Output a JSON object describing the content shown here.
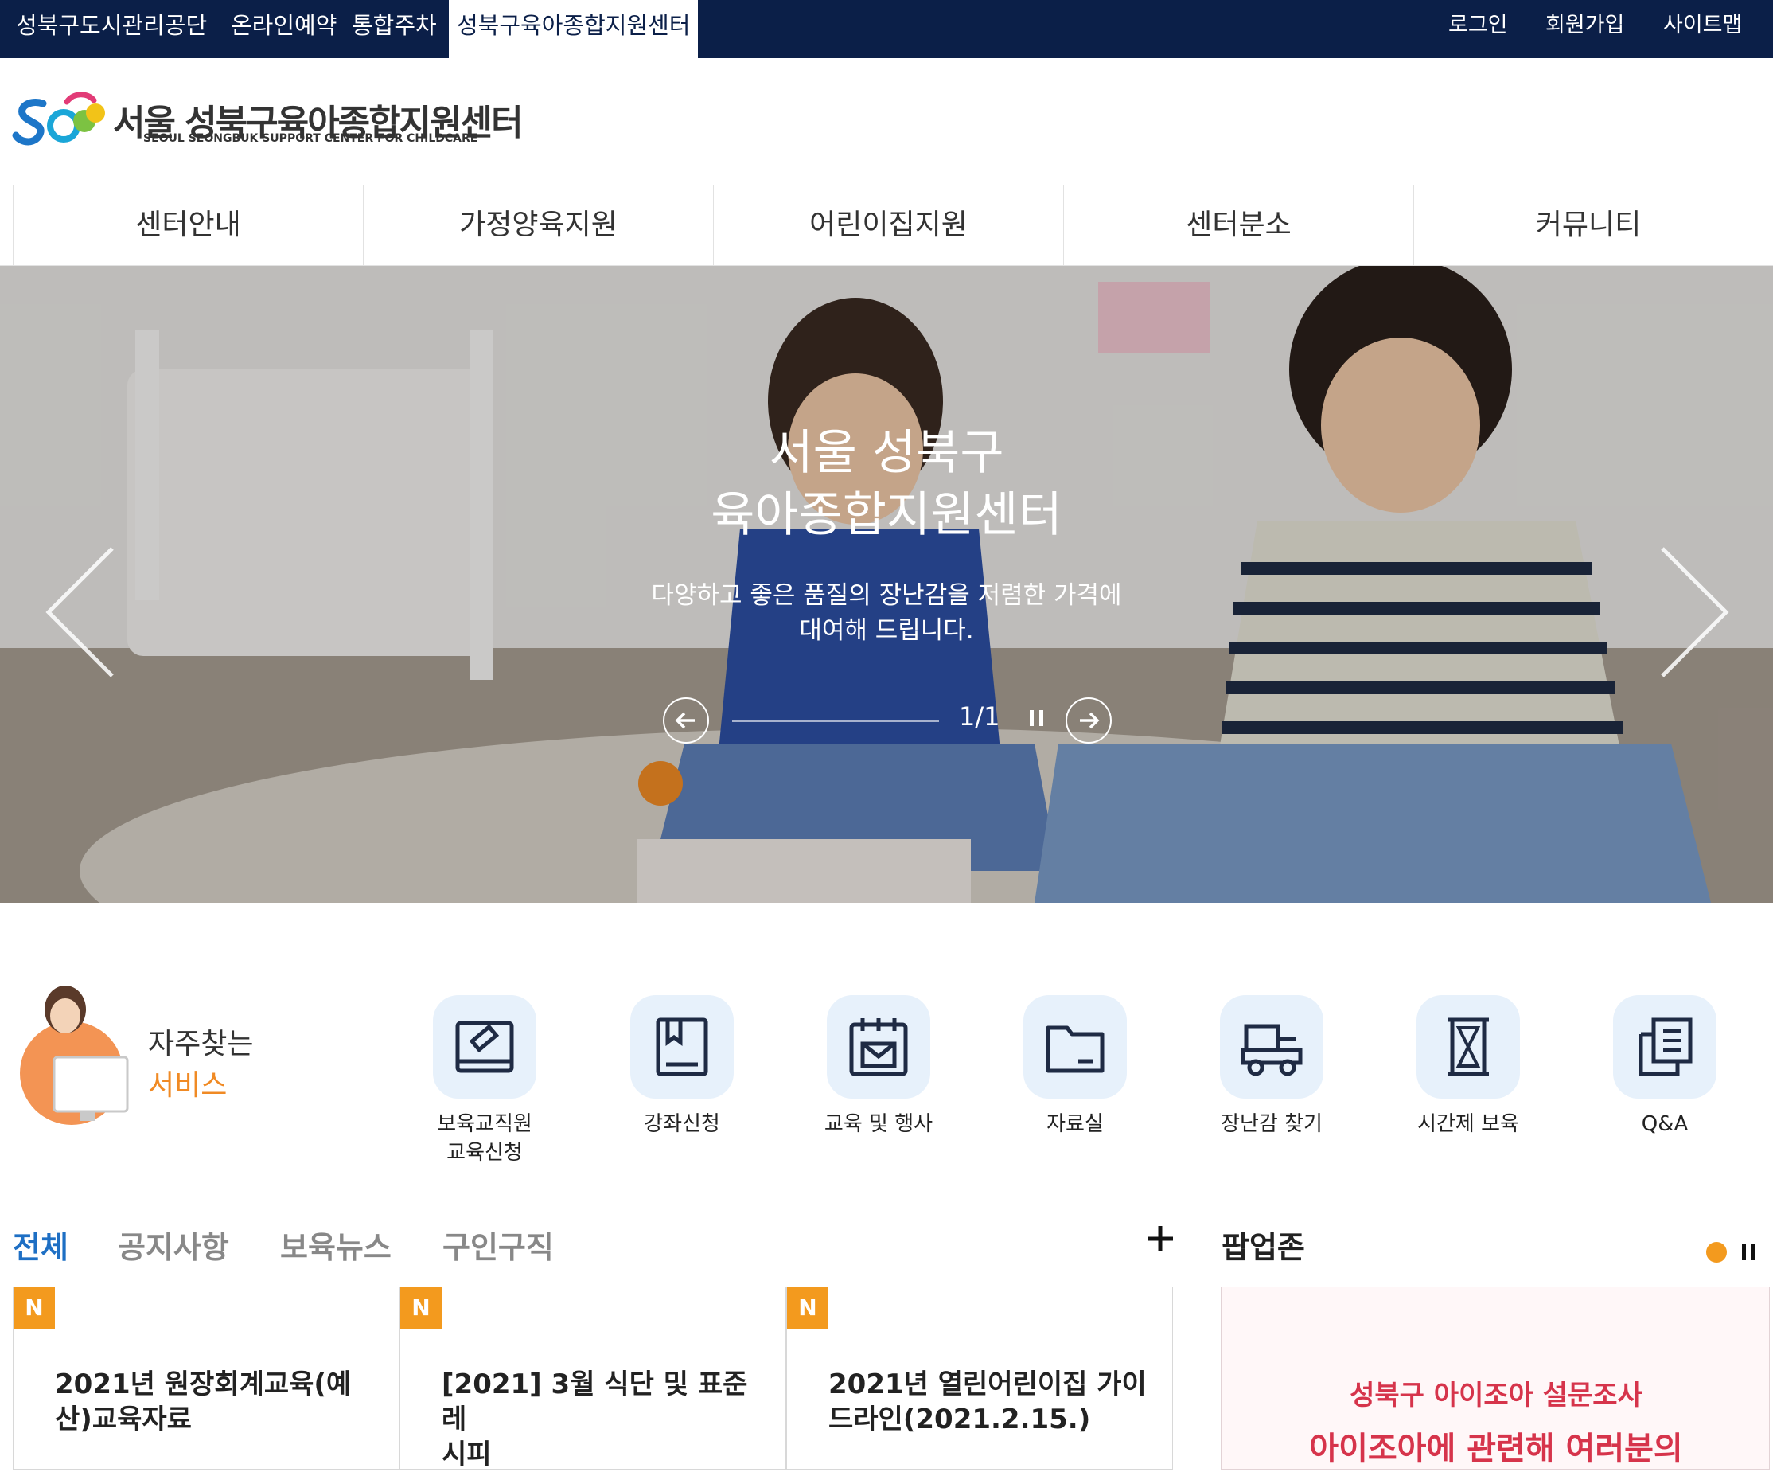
{
  "topbar": {
    "sites": [
      "성북구도시관리공단",
      "온라인예약",
      "통합주차",
      "성북구육아종합지원센터"
    ],
    "utils": [
      "로그인",
      "회원가입",
      "사이트맵"
    ]
  },
  "logo": {
    "name": "서울 성북구육아종합지원센터",
    "en": "SEOUL SEONGBUK SUPPORT CENTER FOR CHILDCARE"
  },
  "nav": [
    "센터안내",
    "가정양육지원",
    "어린이집지원",
    "센터분소",
    "커뮤니티"
  ],
  "hero": {
    "title_line1": "서울 성북구",
    "title_line2": "육아종합지원센터",
    "sub_line1": "다양하고 좋은 품질의 장난감을 저렴한 가격에",
    "sub_line2": "대여해 드립니다.",
    "counter": "1/1"
  },
  "quick": {
    "title1": "자주찾는",
    "title2": "서비스",
    "items": [
      {
        "label1": "보육교직원",
        "label2": "교육신청",
        "icon": "pencil-eraser-icon"
      },
      {
        "label1": "강좌신청",
        "label2": "",
        "icon": "book-bookmark-icon"
      },
      {
        "label1": "교육 및 행사",
        "label2": "",
        "icon": "calendar-mail-icon"
      },
      {
        "label1": "자료실",
        "label2": "",
        "icon": "folder-icon"
      },
      {
        "label1": "장난감 찾기",
        "label2": "",
        "icon": "toy-truck-icon"
      },
      {
        "label1": "시간제 보육",
        "label2": "",
        "icon": "hourglass-icon"
      },
      {
        "label1": "Q&A",
        "label2": "",
        "icon": "document-icon"
      }
    ]
  },
  "board": {
    "tabs": [
      "전체",
      "공지사항",
      "보육뉴스",
      "구인구직"
    ],
    "cards": [
      {
        "badge": "N",
        "line1": "2021년 원장회계교육(예",
        "line2": "산)교육자료"
      },
      {
        "badge": "N",
        "line1": "[2021] 3월 식단 및 표준레",
        "line2": "시피"
      },
      {
        "badge": "N",
        "line1": "2021년 열린어린이집 가이",
        "line2": "드라인(2021.2.15.)"
      }
    ]
  },
  "popupzone": {
    "title": "팝업존",
    "line1": "성북구 아이조아 설문조사",
    "line2": "아이조아에 관련해 여러분의"
  },
  "colors": {
    "navy": "#0b1f48",
    "accent_blue": "#1e6fc4",
    "orange": "#f39a1e",
    "red": "#d6344b"
  }
}
